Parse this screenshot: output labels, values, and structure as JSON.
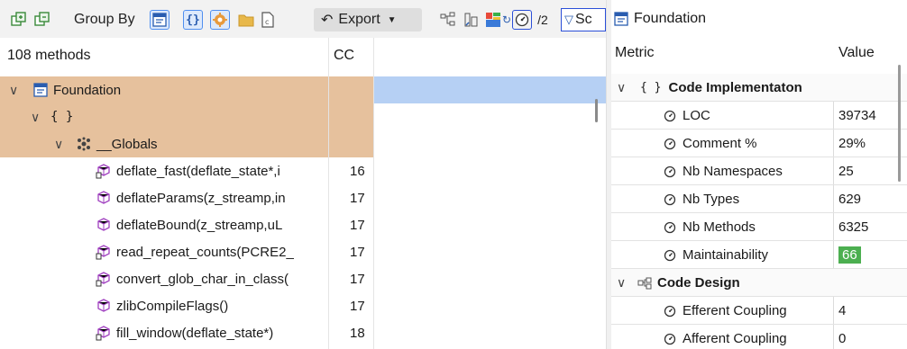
{
  "toolbar": {
    "group_by_label": "Group By",
    "export_label": "Export",
    "search_text": "Sc",
    "items_count_partial": "/2",
    "colors": {
      "selected_bg": "#dde9fb",
      "selected_border": "#4f8ff0",
      "search_border": "#2b4fd8"
    }
  },
  "tree": {
    "header": {
      "count_label": "108 methods",
      "cc_label": "CC"
    },
    "rows": [
      {
        "label": "Foundation",
        "cc": "",
        "icon": "assembly-icon",
        "expanded": true
      },
      {
        "label": "{ }",
        "cc": "",
        "icon": "namespace-icon",
        "expanded": true
      },
      {
        "label": "__Globals",
        "cc": "",
        "icon": "globals-icon",
        "expanded": true
      },
      {
        "label": "deflate_fast(deflate_state*,i",
        "cc": "16",
        "icon": "method-static-icon"
      },
      {
        "label": "deflateParams(z_streamp,in",
        "cc": "17",
        "icon": "method-icon"
      },
      {
        "label": "deflateBound(z_streamp,uL",
        "cc": "17",
        "icon": "method-icon"
      },
      {
        "label": "read_repeat_counts(PCRE2_",
        "cc": "17",
        "icon": "method-static-icon"
      },
      {
        "label": "convert_glob_char_in_class(",
        "cc": "17",
        "icon": "method-static-icon"
      },
      {
        "label": "zlibCompileFlags()",
        "cc": "17",
        "icon": "method-icon"
      },
      {
        "label": "fill_window(deflate_state*)",
        "cc": "18",
        "icon": "method-static-icon"
      }
    ],
    "colors": {
      "highlight": "#e6c19d",
      "selection": "#b6d0f4"
    }
  },
  "metrics": {
    "title": "Foundation",
    "header": {
      "metric": "Metric",
      "value": "Value"
    },
    "rows": [
      {
        "kind": "group",
        "label": "Code Implementaton",
        "prefix": "{ }",
        "value": ""
      },
      {
        "kind": "item",
        "label": "LOC",
        "value": "39734"
      },
      {
        "kind": "item",
        "label": "Comment %",
        "value": "29%"
      },
      {
        "kind": "item",
        "label": "Nb Namespaces",
        "value": "25"
      },
      {
        "kind": "item",
        "label": "Nb Types",
        "value": "629"
      },
      {
        "kind": "item",
        "label": "Nb Methods",
        "value": "6325"
      },
      {
        "kind": "item",
        "label": "Maintainability",
        "value": "66",
        "badge": true
      },
      {
        "kind": "group",
        "label": "Code Design",
        "prefix": "",
        "value": ""
      },
      {
        "kind": "item",
        "label": "Efferent Coupling",
        "value": "4"
      },
      {
        "kind": "item",
        "label": "Afferent Coupling",
        "value": "0"
      }
    ],
    "colors": {
      "badge": "#4caf50"
    }
  }
}
